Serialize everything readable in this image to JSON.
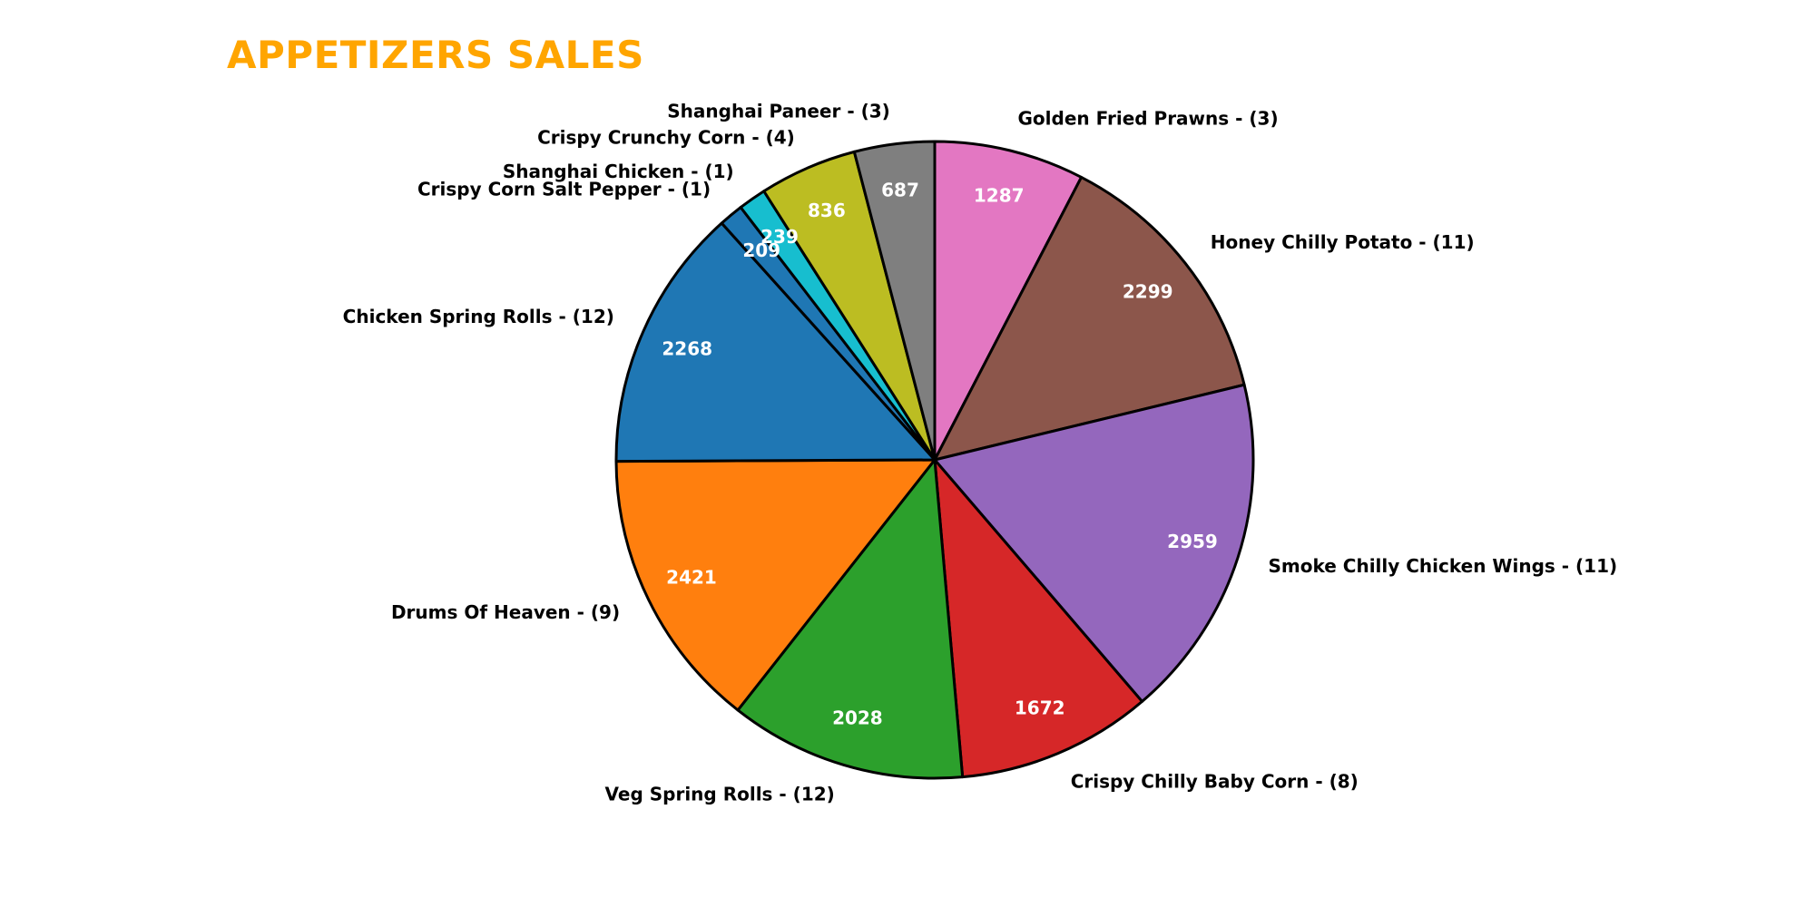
{
  "chart_data": {
    "type": "pie",
    "title": "APPETIZERS SALES",
    "title_color": "#FFA500",
    "start_angle_deg": 90,
    "direction": "clockwise",
    "edge_color": "#000000",
    "slices": [
      {
        "label": "Golden Fried Prawns - (3)",
        "value": 1287,
        "color": "#e377c2"
      },
      {
        "label": "Honey Chilly Potato - (11)",
        "value": 2299,
        "color": "#8c564b"
      },
      {
        "label": "Smoke Chilly Chicken Wings - (11)",
        "value": 2959,
        "color": "#9467bd"
      },
      {
        "label": "Crispy Chilly Baby Corn - (8)",
        "value": 1672,
        "color": "#d62728"
      },
      {
        "label": "Veg Spring Rolls - (12)",
        "value": 2028,
        "color": "#2ca02c"
      },
      {
        "label": "Drums Of Heaven - (9)",
        "value": 2421,
        "color": "#ff7f0e"
      },
      {
        "label": "Chicken Spring Rolls - (12)",
        "value": 2268,
        "color": "#1f77b4"
      },
      {
        "label": "Crispy Corn Salt Pepper - (1)",
        "value": 209,
        "color": "#1f77b4"
      },
      {
        "label": "Shanghai Chicken - (1)",
        "value": 239,
        "color": "#17becf"
      },
      {
        "label": "Crispy Crunchy Corn - (4)",
        "value": 836,
        "color": "#bcbd22"
      },
      {
        "label": "Shanghai Paneer - (3)",
        "value": 687,
        "color": "#7f7f7f"
      }
    ]
  }
}
